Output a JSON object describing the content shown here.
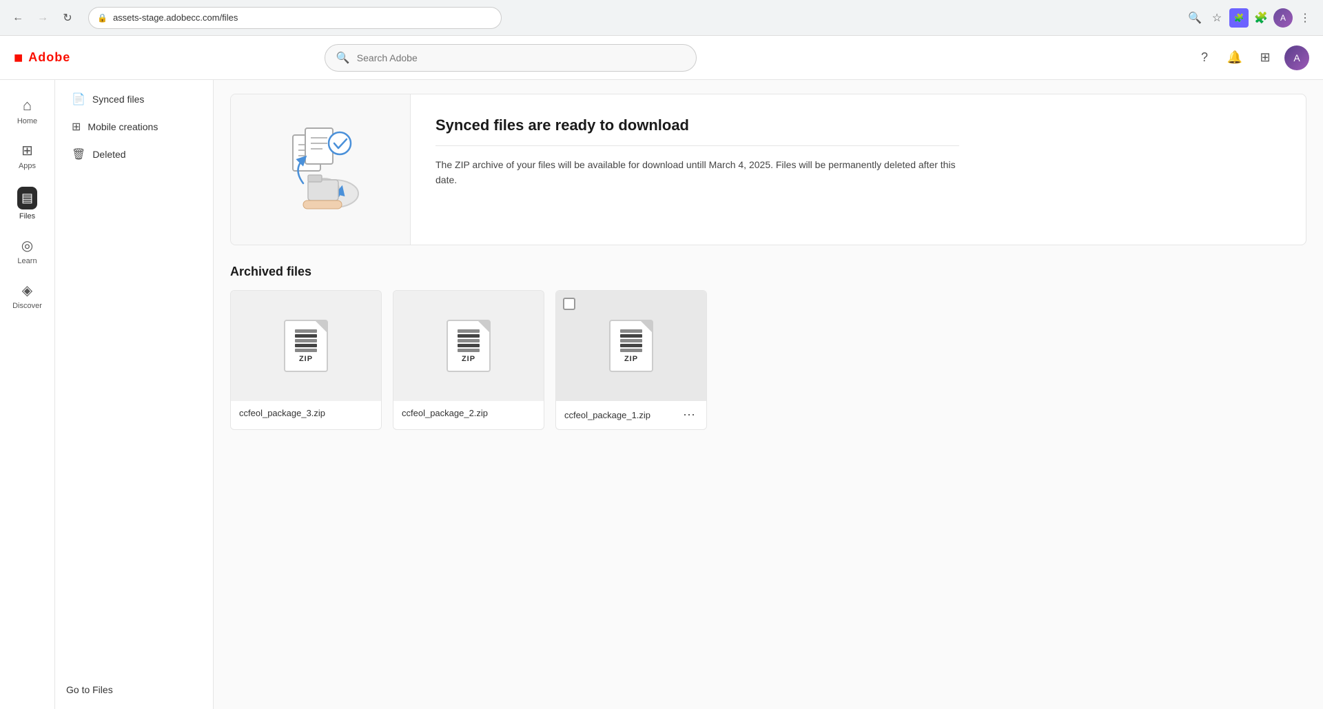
{
  "browser": {
    "url": "assets-stage.adobecc.com/files",
    "back_disabled": false,
    "forward_disabled": true
  },
  "header": {
    "logo_text": "Adobe",
    "search_placeholder": "Search Adobe"
  },
  "icon_sidebar": {
    "items": [
      {
        "id": "home",
        "label": "Home",
        "icon": "⌂",
        "active": false
      },
      {
        "id": "apps",
        "label": "Apps",
        "icon": "⊞",
        "active": false
      },
      {
        "id": "files",
        "label": "Files",
        "icon": "▣",
        "active": true
      },
      {
        "id": "learn",
        "label": "Learn",
        "icon": "◎",
        "active": false
      },
      {
        "id": "discover",
        "label": "Discover",
        "icon": "◈",
        "active": false
      }
    ]
  },
  "nav_panel": {
    "items": [
      {
        "id": "synced-files",
        "label": "Synced files",
        "icon": "📄",
        "active": false
      },
      {
        "id": "mobile-creations",
        "label": "Mobile creations",
        "icon": "⊞",
        "active": false
      },
      {
        "id": "deleted",
        "label": "Deleted",
        "icon": "🗑",
        "active": false
      }
    ],
    "bottom_link": "Go to Files"
  },
  "banner": {
    "title": "Synced files are ready to download",
    "description": "The ZIP archive of your files will be available for download untill March 4, 2025. Files will be permanently deleted after this date."
  },
  "archived_section": {
    "title": "Archived files",
    "files": [
      {
        "id": "file-1",
        "name": "ccfeol_package_3.zip",
        "selected": false,
        "show_menu": false
      },
      {
        "id": "file-2",
        "name": "ccfeol_package_2.zip",
        "selected": false,
        "show_menu": false
      },
      {
        "id": "file-3",
        "name": "ccfeol_package_1.zip",
        "selected": true,
        "show_menu": true
      }
    ]
  }
}
